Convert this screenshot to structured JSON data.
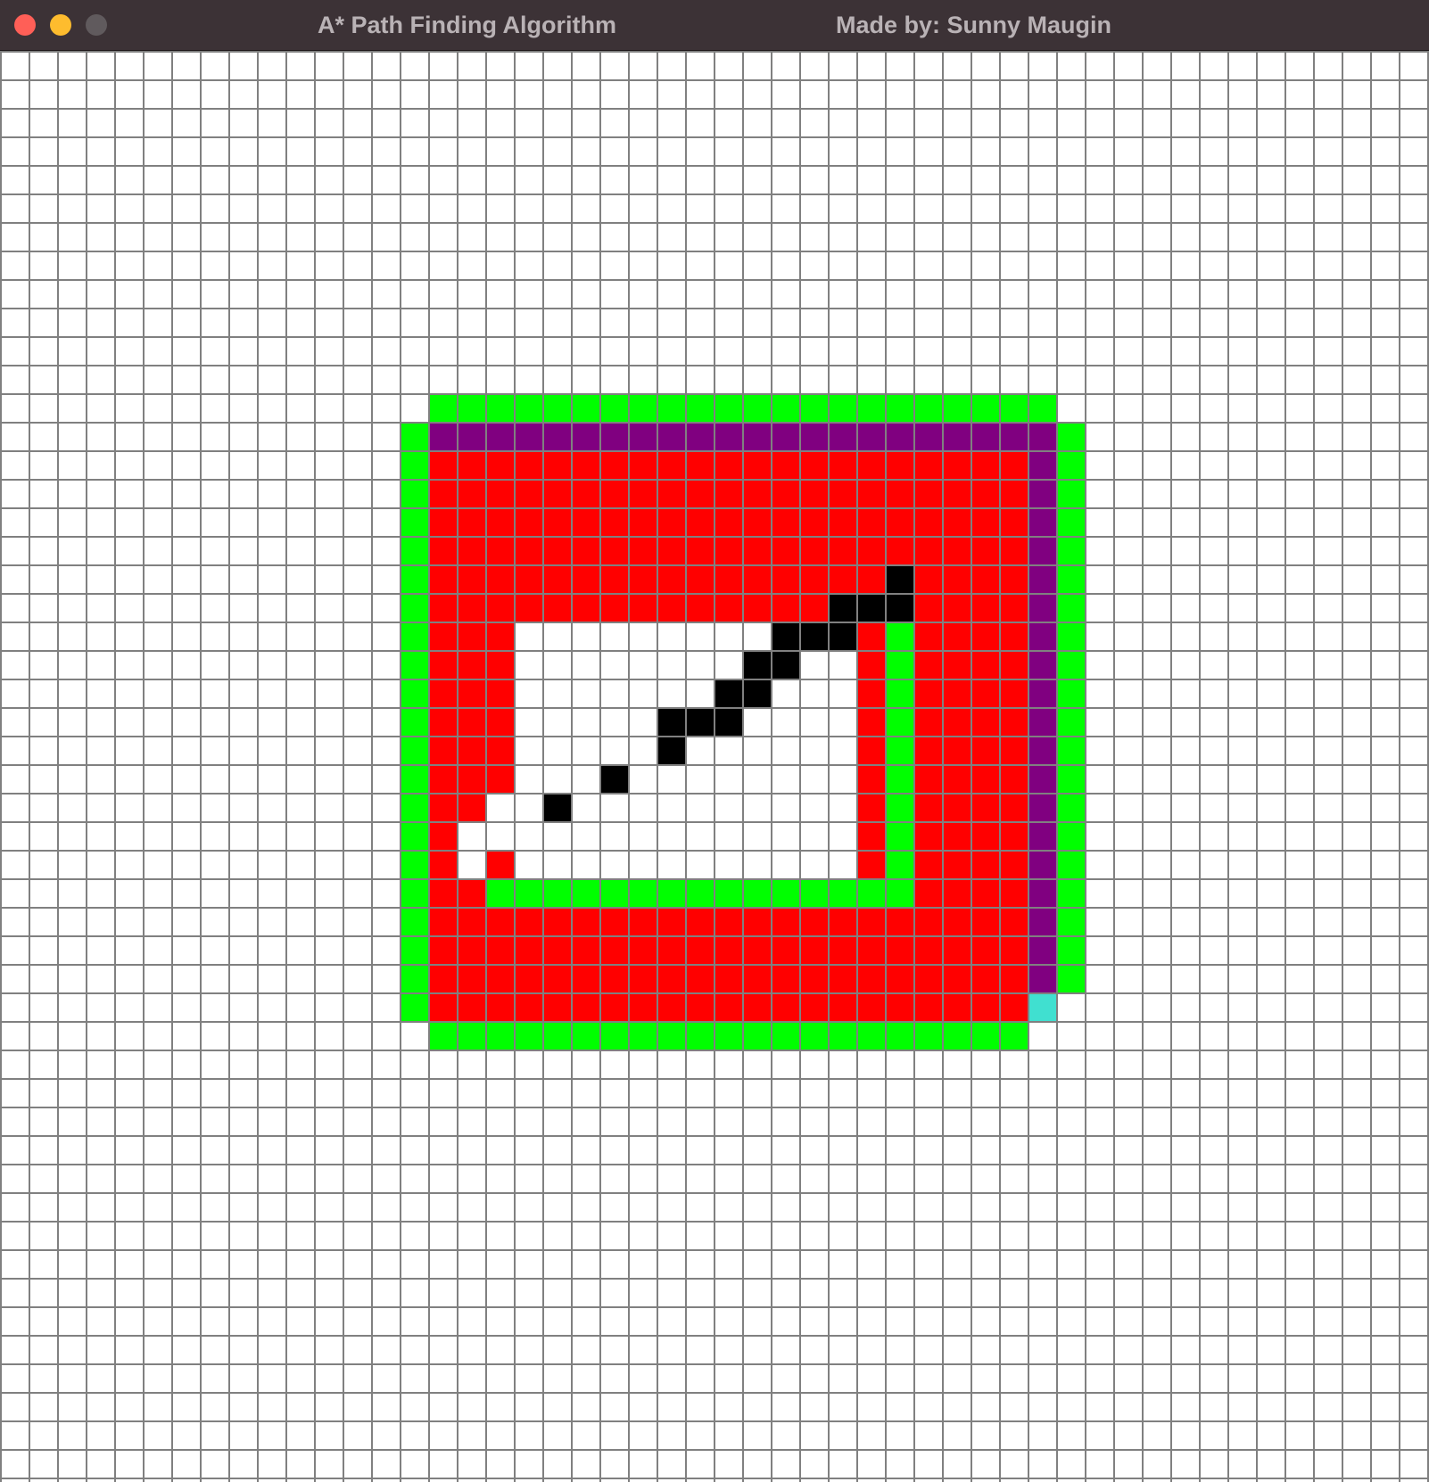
{
  "window": {
    "title": "A* Path Finding Algorithm",
    "credit": "Made by: Sunny Maugin",
    "controls": [
      {
        "name": "close",
        "color": "#ff5f57"
      },
      {
        "name": "minimize",
        "color": "#febc2e"
      },
      {
        "name": "zoom",
        "color": "#605a5d"
      }
    ]
  },
  "grid": {
    "columns": 50,
    "rows": 50,
    "line_color": "#808080",
    "cell_colors": {
      "empty": "#ffffff",
      "open": "#00ff00",
      "closed": "#ff0000",
      "barrier": "#000000",
      "path": "#800080",
      "start": "#40e0d0"
    },
    "regions": [
      {
        "type": "open",
        "col": 15,
        "row": 12,
        "w": 22,
        "h": 1
      },
      {
        "type": "open",
        "col": 14,
        "row": 13,
        "w": 1,
        "h": 21
      },
      {
        "type": "open",
        "col": 37,
        "row": 13,
        "w": 1,
        "h": 20
      },
      {
        "type": "open",
        "col": 15,
        "row": 34,
        "w": 21,
        "h": 1
      },
      {
        "type": "path",
        "col": 15,
        "row": 13,
        "w": 22,
        "h": 1
      },
      {
        "type": "path",
        "col": 36,
        "row": 14,
        "w": 1,
        "h": 19
      },
      {
        "type": "closed",
        "col": 15,
        "row": 14,
        "w": 21,
        "h": 19
      },
      {
        "type": "closed",
        "col": 15,
        "row": 33,
        "w": 21,
        "h": 1
      },
      {
        "type": "empty",
        "col": 18,
        "row": 20,
        "w": 12,
        "h": 9
      },
      {
        "type": "open",
        "col": 31,
        "row": 20,
        "w": 1,
        "h": 10
      },
      {
        "type": "open",
        "col": 17,
        "row": 29,
        "w": 14,
        "h": 1
      },
      {
        "type": "start",
        "col": 36,
        "row": 33,
        "w": 1,
        "h": 1
      }
    ],
    "cells": [
      {
        "type": "barrier",
        "col": 31,
        "row": 18
      },
      {
        "type": "barrier",
        "col": 29,
        "row": 19
      },
      {
        "type": "barrier",
        "col": 30,
        "row": 19
      },
      {
        "type": "barrier",
        "col": 31,
        "row": 19
      },
      {
        "type": "barrier",
        "col": 27,
        "row": 20
      },
      {
        "type": "barrier",
        "col": 28,
        "row": 20
      },
      {
        "type": "barrier",
        "col": 29,
        "row": 20
      },
      {
        "type": "barrier",
        "col": 26,
        "row": 21
      },
      {
        "type": "barrier",
        "col": 27,
        "row": 21
      },
      {
        "type": "barrier",
        "col": 25,
        "row": 22
      },
      {
        "type": "barrier",
        "col": 26,
        "row": 22
      },
      {
        "type": "barrier",
        "col": 23,
        "row": 23
      },
      {
        "type": "barrier",
        "col": 24,
        "row": 23
      },
      {
        "type": "barrier",
        "col": 25,
        "row": 23
      },
      {
        "type": "barrier",
        "col": 21,
        "row": 24
      },
      {
        "type": "barrier",
        "col": 22,
        "row": 24
      },
      {
        "type": "barrier",
        "col": 23,
        "row": 24
      },
      {
        "type": "barrier",
        "col": 20,
        "row": 25
      },
      {
        "type": "barrier",
        "col": 21,
        "row": 25
      },
      {
        "type": "barrier",
        "col": 18,
        "row": 26
      },
      {
        "type": "barrier",
        "col": 19,
        "row": 26
      },
      {
        "type": "barrier",
        "col": 17,
        "row": 27
      },
      {
        "type": "barrier",
        "col": 16,
        "row": 28
      },
      {
        "type": "empty",
        "col": 20,
        "row": 24
      },
      {
        "type": "empty",
        "col": 21,
        "row": 24
      },
      {
        "type": "empty",
        "col": 22,
        "row": 24
      },
      {
        "type": "empty",
        "col": 19,
        "row": 25
      },
      {
        "type": "empty",
        "col": 20,
        "row": 25
      },
      {
        "type": "empty",
        "col": 17,
        "row": 26
      },
      {
        "type": "empty",
        "col": 18,
        "row": 26
      },
      {
        "type": "empty",
        "col": 16,
        "row": 27
      },
      {
        "type": "empty",
        "col": 17,
        "row": 27
      },
      {
        "type": "empty",
        "col": 16,
        "row": 28
      }
    ]
  }
}
